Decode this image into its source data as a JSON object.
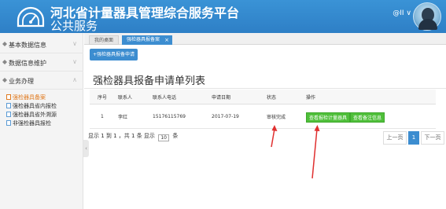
{
  "header": {
    "title_line1": "河北省计量器具管理综合服务平台",
    "title_line2": "公共服务",
    "user_text": "@II ∨"
  },
  "sidebar": {
    "menus": [
      {
        "label": "基本数据信息"
      },
      {
        "label": "数据信息维护"
      },
      {
        "label": "业务办理"
      }
    ],
    "subitems": [
      {
        "label": "强检器具备案",
        "active": true
      },
      {
        "label": "强检器具省内报检"
      },
      {
        "label": "强检器具省外溯源"
      },
      {
        "label": "非强检器具报检"
      }
    ]
  },
  "tabs": [
    {
      "label": "我的桌面"
    },
    {
      "label": "强检器具报备案",
      "close": "×"
    }
  ],
  "toolbar": {
    "apply_label": "+强检器具报备申请"
  },
  "page": {
    "title": "强检器具报备申请单列表"
  },
  "table": {
    "headers": [
      "序号",
      "联系人",
      "联系人电话",
      "申请日期",
      "状态",
      "操作"
    ],
    "rows": [
      {
        "index": "1",
        "contact": "李红",
        "phone": "15176115769",
        "date": "2017-07-19",
        "status": "审核完成",
        "action1": "查看报检计量器具",
        "action2": "查看备注信息"
      }
    ]
  },
  "pager": {
    "info_prefix": "显示 1 到 1 ，共 1 条  显示",
    "page_size": "10",
    "info_suffix": "条",
    "prev": "上一页",
    "current": "1",
    "next": "下一页"
  },
  "colors": {
    "header": "#2e7fc6",
    "accent": "#3c8dd0",
    "green": "#4fbf3a",
    "arrow": "#e03030",
    "active_menu": "#e07a1f"
  }
}
